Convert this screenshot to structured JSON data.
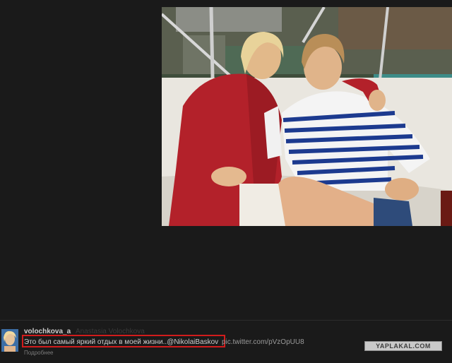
{
  "tweet": {
    "username": "volochkova_a",
    "fullname": "Anastasia Volochkova",
    "text": "Это был самый яркий отдых в моей жизни..",
    "mention": "@NikolaiBaskov",
    "pic_link": "pic.twitter.com/pVzOpUU8",
    "more_label": "Подробнее"
  },
  "watermark": {
    "text": "YAPLAKAL.COM"
  },
  "colors": {
    "page_background": "#1a1a1a",
    "highlight_border": "#d11c1c",
    "water": "#4fbfb9",
    "robe": "#b3212a"
  },
  "photo": {
    "icon": "photo-icon"
  }
}
